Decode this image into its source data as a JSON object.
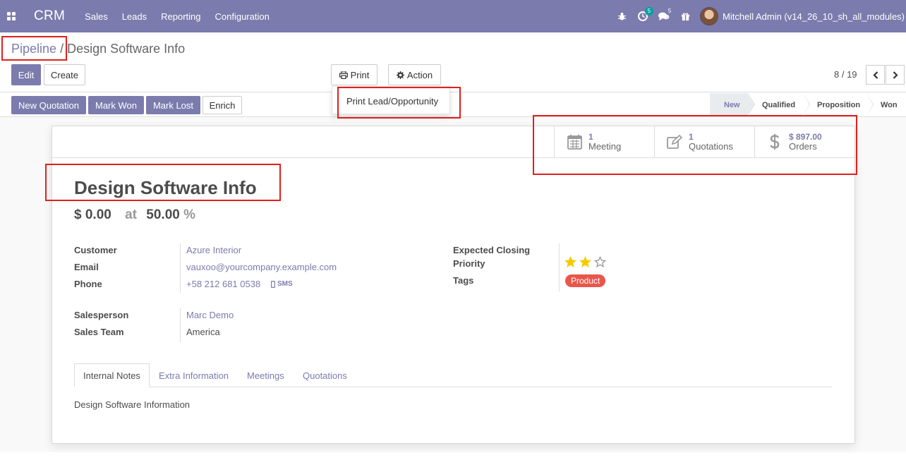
{
  "navbar": {
    "app_name": "CRM",
    "menus": [
      "Sales",
      "Leads",
      "Reporting",
      "Configuration"
    ],
    "activity_count": "5",
    "message_count": "5",
    "user_name": "Mitchell Admin (v14_26_10_sh_all_modules)",
    "color": "#7c7bad"
  },
  "breadcrumb": {
    "parent": "Pipeline",
    "separator": "/",
    "current": "Design Software Info"
  },
  "toolbar": {
    "edit_label": "Edit",
    "create_label": "Create",
    "print_label": "Print",
    "action_label": "Action",
    "print_menu_item": "Print Lead/Opportunity",
    "pager_value": "8 / 19"
  },
  "header": {
    "buttons": [
      "New Quotation",
      "Mark Won",
      "Mark Lost",
      "Enrich"
    ],
    "stages": [
      "New",
      "Qualified",
      "Proposition",
      "Won"
    ],
    "active_stage": "New"
  },
  "smart_buttons": [
    {
      "value": "1",
      "label": "Meeting",
      "icon": "calendar-icon"
    },
    {
      "value": "1",
      "label": "Quotations",
      "icon": "edit-icon"
    },
    {
      "value": "$ 897.00",
      "label": "Orders",
      "icon": "dollar-icon"
    }
  ],
  "lead": {
    "name": "Design Software Info",
    "expected_revenue": "$ 0.00",
    "at_label": "at",
    "probability": "50.00",
    "probability_unit": "%"
  },
  "fields": {
    "customer_label": "Customer",
    "customer": "Azure Interior",
    "email_label": "Email",
    "email": "vauxoo@yourcompany.example.com",
    "phone_label": "Phone",
    "phone": "+58 212 681 0538",
    "sms_label": "SMS",
    "salesperson_label": "Salesperson",
    "salesperson": "Marc Demo",
    "team_label": "Sales Team",
    "team": "America",
    "closing_label": "Expected Closing",
    "priority_label": "Priority",
    "priority": 2,
    "priority_max": 3,
    "tags_label": "Tags",
    "tag": "Product"
  },
  "tabs": [
    "Internal Notes",
    "Extra Information",
    "Meetings",
    "Quotations"
  ],
  "notes": "Design Software Information",
  "colors": {
    "accent": "#7c7bad",
    "tag": "#e9564a",
    "star": "#f3cc00",
    "highlight": "#e0201b"
  }
}
